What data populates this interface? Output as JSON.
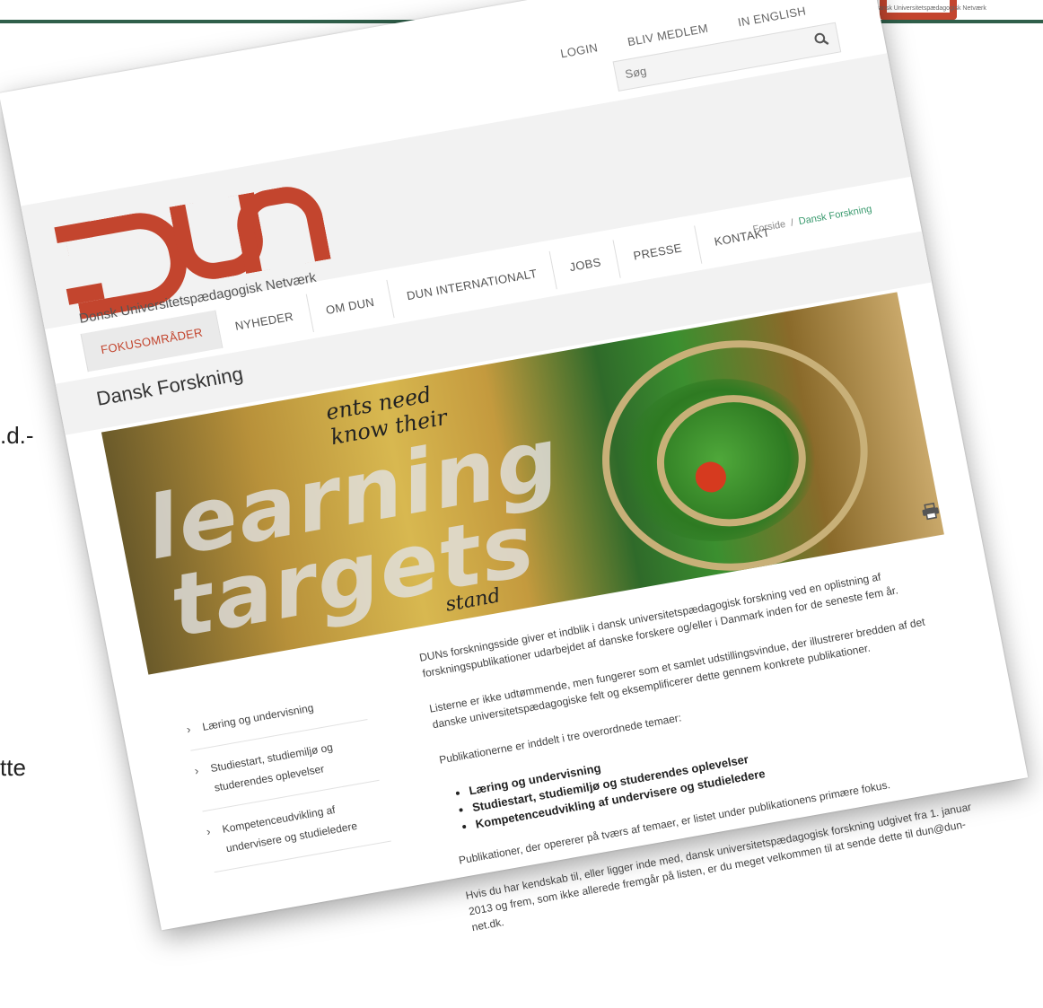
{
  "slide": {
    "frag_1": ".d.-",
    "frag_2": "tte",
    "corner_logo_text": "Dansk Universitetspædagogisk Netværk"
  },
  "utility_nav": {
    "login": "LOGIN",
    "member": "BLIV MEDLEM",
    "english": "IN ENGLISH"
  },
  "search": {
    "placeholder": "Søg"
  },
  "logo": {
    "text": "Donsk Universitetspædagogisk Netværk"
  },
  "main_nav": [
    {
      "label": "FOKUSOMRÅDER"
    },
    {
      "label": "NYHEDER"
    },
    {
      "label": "OM DUN"
    },
    {
      "label": "DUN INTERNATIONALT"
    },
    {
      "label": "JOBS"
    },
    {
      "label": "PRESSE"
    },
    {
      "label": "KONTAKT"
    }
  ],
  "breadcrumb": {
    "home": "Forside",
    "sep": "/",
    "current": "Dansk Forskning"
  },
  "page_title": "Dansk Forskning",
  "hero": {
    "small_line_1": "ents need",
    "small_line_2": "know their",
    "big_line_1": "learning",
    "big_line_2": "targets",
    "small_line_3": "stand"
  },
  "sidebar": [
    {
      "label": "Læring og undervisning"
    },
    {
      "label": "Studiestart, studiemiljø og studerendes oplevelser"
    },
    {
      "label": "Kompetenceudvikling af undervisere og studieledere"
    }
  ],
  "content": {
    "p1": "DUNs forskningsside giver et indblik i dansk universitetspædagogisk forskning ved en oplistning af forskningspublikationer udarbejdet af danske forskere og/eller i Danmark inden for de seneste fem år.",
    "p2": "Listerne er ikke udtømmende, men fungerer som et samlet udstillingsvindue, der illustrerer bredden af det danske universitetspædagogiske felt og eksemplificerer dette gennem konkrete publikationer.",
    "p3": "Publikationerne er inddelt i tre overordnede temaer:",
    "bullets": [
      "Læring og undervisning",
      "Studiestart, studiemiljø og studerendes oplevelser",
      "Kompetenceudvikling af undervisere og studieledere"
    ],
    "p4": "Publikationer, der opererer på tværs af temaer, er listet under publikationens primære fokus.",
    "p5": "Hvis du har kendskab til, eller ligger inde med, dansk universitetspædagogisk forskning udgivet fra 1. januar 2013 og frem, som ikke allerede fremgår på listen, er du meget velkommen til at sende dette til dun@dun-net.dk."
  },
  "colors": {
    "brand_red": "#c3452e",
    "slide_green": "#2f5f4a",
    "link_green": "#3a9a6e"
  }
}
